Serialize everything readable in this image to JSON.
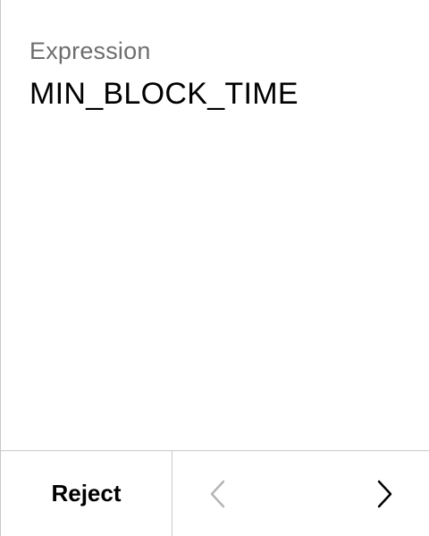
{
  "field": {
    "label": "Expression",
    "value": "MIN_BLOCK_TIME"
  },
  "footer": {
    "reject_label": "Reject",
    "prev_icon": "chevron-left-icon",
    "next_icon": "chevron-right-icon",
    "prev_color": "#b5b5b5",
    "next_color": "#000000"
  }
}
